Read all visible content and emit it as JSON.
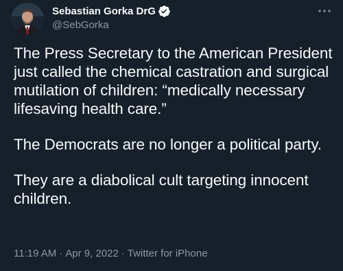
{
  "colors": {
    "background": "#15202b",
    "text_primary": "#f7f9f9",
    "text_secondary": "#8b98a5",
    "verified_badge": "#1d9bf0"
  },
  "author": {
    "display_name": "Sebastian Gorka DrG",
    "handle": "@SebGorka",
    "verified_icon": "verified-badge-icon",
    "avatar_icon": "profile-photo"
  },
  "more_icon": "more-options-icon",
  "tweet": {
    "paragraphs": [
      "The Press Secretary to the American President just called the chemical castration and surgical mutilation of children: “medically necessary lifesaving health care.”",
      "The Democrats are no longer a political party.",
      "They are a diabolical cult targeting innocent children."
    ]
  },
  "meta": {
    "time": "11:19 AM",
    "date": "Apr 9, 2022",
    "separator": "·",
    "source": "Twitter for iPhone"
  }
}
